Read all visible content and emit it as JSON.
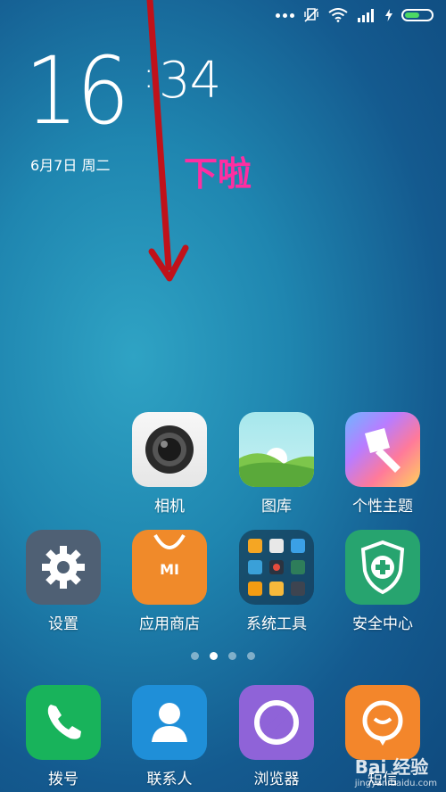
{
  "clock": {
    "hours": "16",
    "colon": ":",
    "minutes": "34"
  },
  "date": "6月7日 周二",
  "annotation": "下啦",
  "battery_level": 0.58,
  "colors": {
    "annotation": "#ff2ea1",
    "arrow": "#c0121a",
    "battery": "#4cd964"
  },
  "apps_row1": [
    {
      "label": "相机",
      "icon": "camera-icon"
    },
    {
      "label": "图库",
      "icon": "gallery-icon"
    },
    {
      "label": "个性主题",
      "icon": "theme-brush-icon"
    }
  ],
  "apps_row2": [
    {
      "label": "设置",
      "icon": "gear-icon"
    },
    {
      "label": "应用商店",
      "icon": "mi-store-icon"
    },
    {
      "label": "系统工具",
      "icon": "folder-grid-icon"
    },
    {
      "label": "安全中心",
      "icon": "shield-plus-icon"
    }
  ],
  "dock": [
    {
      "label": "拨号",
      "icon": "phone-icon"
    },
    {
      "label": "联系人",
      "icon": "contact-person-icon"
    },
    {
      "label": "浏览器",
      "icon": "browser-icon"
    },
    {
      "label": "短信",
      "icon": "message-bubble-icon"
    }
  ],
  "pager": {
    "count": 4,
    "active": 1
  },
  "watermark": {
    "brand": "Bai 经验",
    "url": "jingyan.baidu.com"
  }
}
